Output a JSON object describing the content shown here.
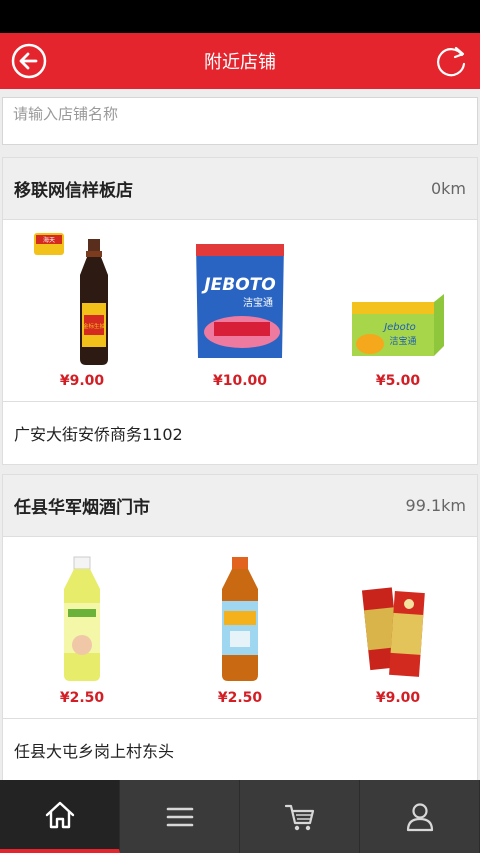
{
  "header": {
    "title": "附近店铺",
    "back_icon": "back-arrow-icon",
    "refresh_icon": "refresh-icon"
  },
  "search": {
    "placeholder": "请输入店铺名称",
    "value": ""
  },
  "stores": [
    {
      "name": "移联网信样板店",
      "distance": "0km",
      "products": [
        {
          "image": "soy-sauce-bottle",
          "brand_text": "海天",
          "label_text": "金标生抽",
          "price": "¥9.00"
        },
        {
          "image": "detergent-bag",
          "brand_text": "JEBOTO",
          "label_text": "洁宝通",
          "price": "¥10.00"
        },
        {
          "image": "soap-box",
          "brand_text": "Jeboto",
          "label_text": "洁宝通",
          "price": "¥5.00"
        }
      ],
      "address": "广安大街安侨商务1102"
    },
    {
      "name": "任县华军烟酒门市",
      "distance": "99.1km",
      "products": [
        {
          "image": "green-tea-bottle",
          "price": "¥2.50"
        },
        {
          "image": "iced-tea-bottle",
          "price": "¥2.50"
        },
        {
          "image": "cigarette-packs",
          "price": "¥9.00"
        }
      ],
      "address": "任县大屯乡岗上村东头"
    }
  ],
  "tabbar": {
    "items": [
      {
        "icon": "home-icon",
        "active": true
      },
      {
        "icon": "list-icon",
        "active": false
      },
      {
        "icon": "cart-icon",
        "active": false
      },
      {
        "icon": "user-icon",
        "active": false
      }
    ]
  },
  "colors": {
    "brand_red": "#e5252d",
    "price_red": "#d21e25",
    "tabbar_bg": "#3a3a3a"
  }
}
